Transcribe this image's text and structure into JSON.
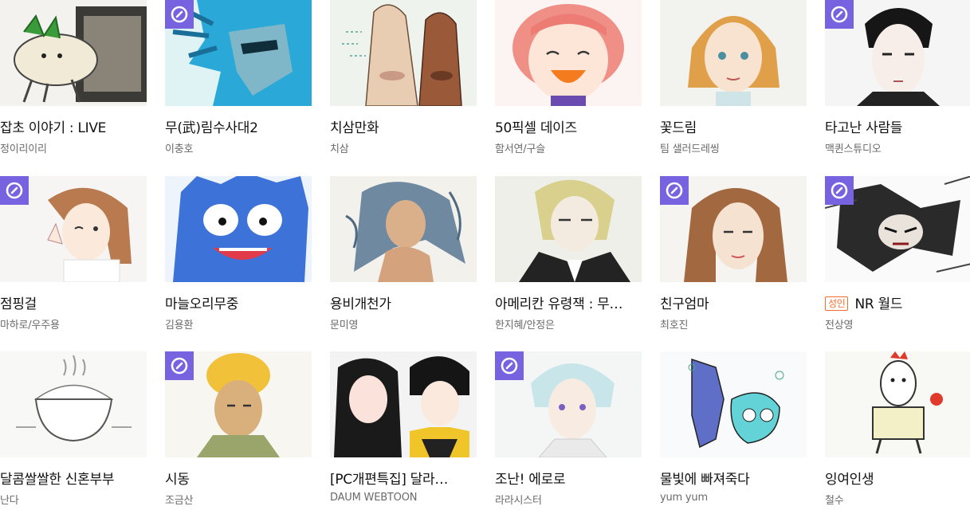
{
  "accent_badge_color": "#7763e0",
  "adult_badge_color": "#f26d2e",
  "cards": [
    {
      "title": "잡초 이야기 : LIVE",
      "author": "정이리이리",
      "icon": "weed-character-thumbnail",
      "time_badge": false
    },
    {
      "title": "무(武)림수사대2",
      "author": "이충호",
      "icon": "blue-haired-man-thumbnail",
      "time_badge": true
    },
    {
      "title": "치삼만화",
      "author": "치삼",
      "icon": "two-faces-thumbnail",
      "time_badge": false
    },
    {
      "title": "50픽셀 데이즈",
      "author": "함서연/구슬",
      "icon": "laughing-girl-thumbnail",
      "time_badge": false
    },
    {
      "title": "꽃드림",
      "author": "팀 샐러드레씽",
      "icon": "blonde-girl-thumbnail",
      "time_badge": false
    },
    {
      "title": "타고난 사람들",
      "author": "맥퀸스튜디오",
      "icon": "pale-man-thumbnail",
      "time_badge": true
    },
    {
      "title": "점핑걸",
      "author": "마하로/우주용",
      "icon": "winking-girl-thumbnail",
      "time_badge": true
    },
    {
      "title": "마늘오리무중",
      "author": "김용환",
      "icon": "blue-monster-thumbnail",
      "time_badge": false
    },
    {
      "title": "용비개천가",
      "author": "문미영",
      "icon": "long-haired-man-thumbnail",
      "time_badge": false
    },
    {
      "title": "아메리칸 유령잭 : 무…",
      "author": "한지혜/안정은",
      "icon": "suited-man-thumbnail",
      "time_badge": false
    },
    {
      "title": "친구엄마",
      "author": "최호진",
      "icon": "woman-portrait-thumbnail",
      "time_badge": true
    },
    {
      "title": "NR 월드",
      "author": "전상영",
      "icon": "action-sketch-thumbnail",
      "time_badge": true,
      "adult_label": "성인"
    },
    {
      "title": "달콤쌀쌀한 신혼부부",
      "author": "난다",
      "icon": "rice-bowl-thumbnail",
      "time_badge": false
    },
    {
      "title": "시동",
      "author": "조금산",
      "icon": "curly-hair-man-thumbnail",
      "time_badge": true
    },
    {
      "title": "[PC개편특집] 달라…",
      "author": "DAUM WEBTOON",
      "icon": "couple-thumbnail",
      "time_badge": false
    },
    {
      "title": "조난! 에로로",
      "author": "라라시스터",
      "icon": "white-haired-man-thumbnail",
      "time_badge": true
    },
    {
      "title": "물빛에 빠져죽다",
      "author": "yum yum",
      "icon": "fish-creatures-thumbnail",
      "time_badge": false
    },
    {
      "title": "잉여인생",
      "author": "철수",
      "icon": "rooster-doll-thumbnail",
      "time_badge": false
    }
  ]
}
